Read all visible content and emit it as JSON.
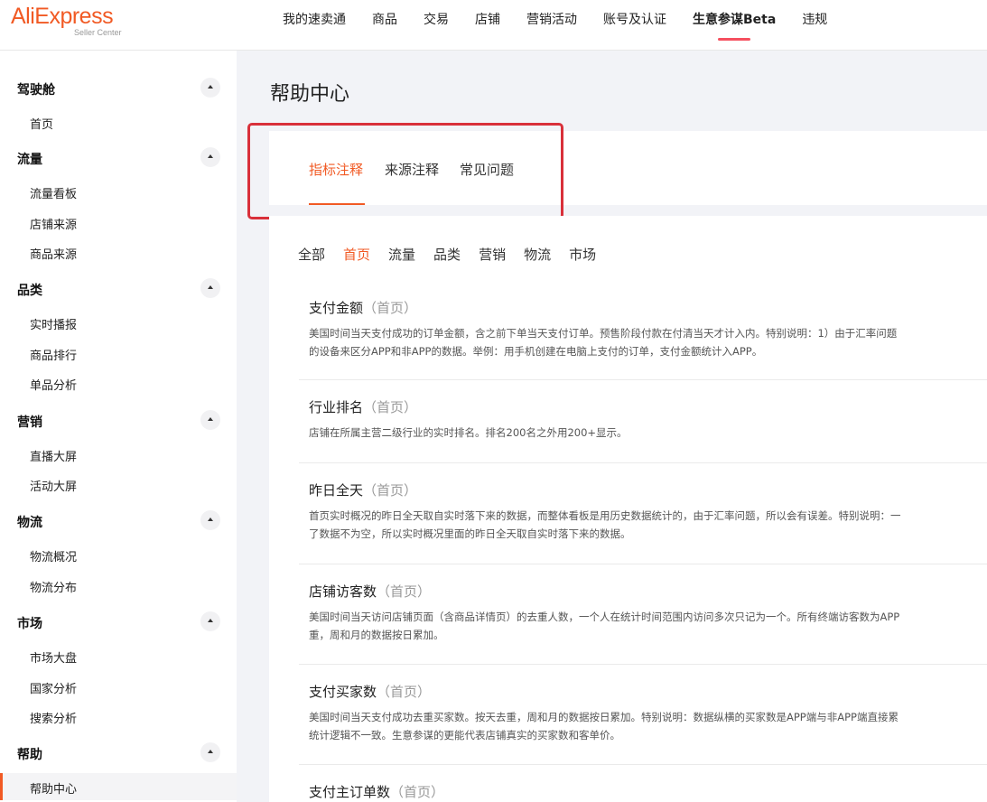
{
  "brand": {
    "name": "AliExpress",
    "sub": "Seller Center",
    "color": "#f15a24"
  },
  "topnav": [
    {
      "label": "我的速卖通"
    },
    {
      "label": "商品"
    },
    {
      "label": "交易"
    },
    {
      "label": "店铺"
    },
    {
      "label": "营销活动"
    },
    {
      "label": "账号及认证"
    },
    {
      "label": "生意参谋Beta",
      "active": true
    },
    {
      "label": "违规"
    }
  ],
  "sidebar": {
    "groups": [
      {
        "label": "驾驶舱",
        "items": [
          "首页"
        ]
      },
      {
        "label": "流量",
        "items": [
          "流量看板",
          "店铺来源",
          "商品来源"
        ]
      },
      {
        "label": "品类",
        "items": [
          "实时播报",
          "商品排行",
          "单品分析"
        ]
      },
      {
        "label": "营销",
        "items": [
          "直播大屏",
          "活动大屏"
        ]
      },
      {
        "label": "物流",
        "items": [
          "物流概况",
          "物流分布"
        ]
      },
      {
        "label": "市场",
        "items": [
          "市场大盘",
          "国家分析",
          "搜索分析"
        ]
      },
      {
        "label": "帮助",
        "items": [
          "帮助中心"
        ]
      }
    ],
    "active_item": "帮助中心"
  },
  "page": {
    "title": "帮助中心",
    "tabs": [
      {
        "label": "指标注释",
        "active": true
      },
      {
        "label": "来源注释"
      },
      {
        "label": "常见问题"
      }
    ],
    "filters": [
      {
        "label": "全部"
      },
      {
        "label": "首页",
        "active": true
      },
      {
        "label": "流量"
      },
      {
        "label": "品类"
      },
      {
        "label": "营销"
      },
      {
        "label": "物流"
      },
      {
        "label": "市场"
      }
    ],
    "entries": [
      {
        "title": "支付金额",
        "tag": "（首页）",
        "desc": [
          "美国时间当天支付成功的订单金额，含之前下单当天支付订单。预售阶段付款在付清当天才计入内。特别说明：1）由于汇率问题",
          "的设备来区分APP和非APP的数据。举例：用手机创建在电脑上支付的订单，支付金额统计入APP。"
        ]
      },
      {
        "title": "行业排名",
        "tag": "（首页）",
        "desc": [
          "店铺在所属主营二级行业的实时排名。排名200名之外用200+显示。"
        ]
      },
      {
        "title": "昨日全天",
        "tag": "（首页）",
        "desc": [
          "首页实时概况的昨日全天取自实时落下来的数据，而整体看板是用历史数据统计的，由于汇率问题，所以会有误差。特别说明：一",
          "了数据不为空，所以实时概况里面的昨日全天取自实时落下来的数据。"
        ]
      },
      {
        "title": "店铺访客数",
        "tag": "（首页）",
        "desc": [
          "美国时间当天访问店铺页面（含商品详情页）的去重人数，一个人在统计时间范围内访问多次只记为一个。所有终端访客数为APP",
          "重，周和月的数据按日累加。"
        ]
      },
      {
        "title": "支付买家数",
        "tag": "（首页）",
        "desc": [
          "美国时间当天支付成功去重买家数。按天去重，周和月的数据按日累加。特别说明：数据纵横的买家数是APP端与非APP端直接累",
          "统计逻辑不一致。生意参谋的更能代表店铺真实的买家数和客单价。"
        ]
      },
      {
        "title": "支付主订单数",
        "tag": "（首页）",
        "desc": []
      }
    ]
  }
}
